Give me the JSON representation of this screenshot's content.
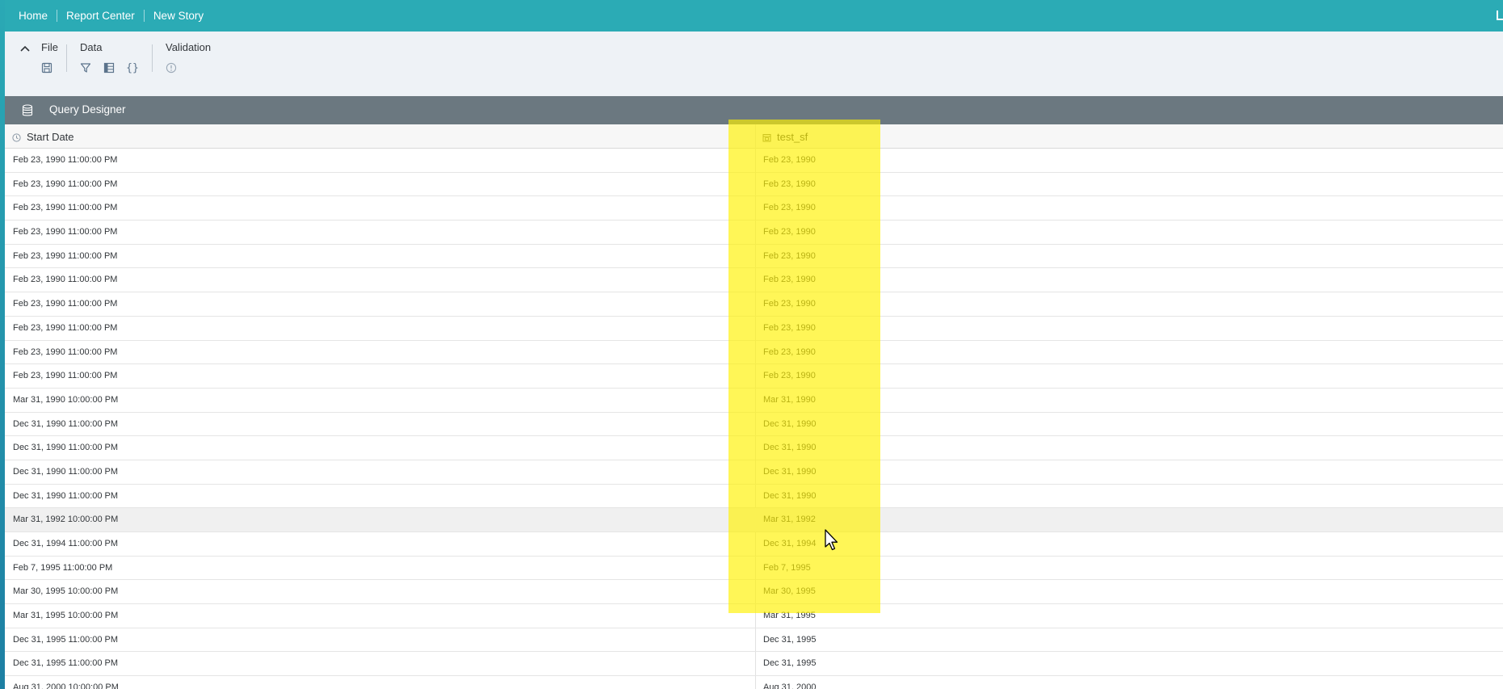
{
  "breadcrumbs": [
    "Home",
    "Report Center",
    "New Story"
  ],
  "toolbar": {
    "groups": {
      "file": "File",
      "data": "Data",
      "validation": "Validation"
    }
  },
  "query_designer": {
    "title": "Query Designer"
  },
  "table": {
    "columns": [
      "Start Date",
      "test_sf"
    ],
    "rows": [
      [
        "Feb 23, 1990 11:00:00 PM",
        "Feb 23, 1990"
      ],
      [
        "Feb 23, 1990 11:00:00 PM",
        "Feb 23, 1990"
      ],
      [
        "Feb 23, 1990 11:00:00 PM",
        "Feb 23, 1990"
      ],
      [
        "Feb 23, 1990 11:00:00 PM",
        "Feb 23, 1990"
      ],
      [
        "Feb 23, 1990 11:00:00 PM",
        "Feb 23, 1990"
      ],
      [
        "Feb 23, 1990 11:00:00 PM",
        "Feb 23, 1990"
      ],
      [
        "Feb 23, 1990 11:00:00 PM",
        "Feb 23, 1990"
      ],
      [
        "Feb 23, 1990 11:00:00 PM",
        "Feb 23, 1990"
      ],
      [
        "Feb 23, 1990 11:00:00 PM",
        "Feb 23, 1990"
      ],
      [
        "Feb 23, 1990 11:00:00 PM",
        "Feb 23, 1990"
      ],
      [
        "Mar 31, 1990 10:00:00 PM",
        "Mar 31, 1990"
      ],
      [
        "Dec 31, 1990 11:00:00 PM",
        "Dec 31, 1990"
      ],
      [
        "Dec 31, 1990 11:00:00 PM",
        "Dec 31, 1990"
      ],
      [
        "Dec 31, 1990 11:00:00 PM",
        "Dec 31, 1990"
      ],
      [
        "Dec 31, 1990 11:00:00 PM",
        "Dec 31, 1990"
      ],
      [
        "Mar 31, 1992 10:00:00 PM",
        "Mar 31, 1992"
      ],
      [
        "Dec 31, 1994 11:00:00 PM",
        "Dec 31, 1994"
      ],
      [
        "Feb 7, 1995 11:00:00 PM",
        "Feb 7, 1995"
      ],
      [
        "Mar 30, 1995 10:00:00 PM",
        "Mar 30, 1995"
      ],
      [
        "Mar 31, 1995 10:00:00 PM",
        "Mar 31, 1995"
      ],
      [
        "Dec 31, 1995 11:00:00 PM",
        "Dec 31, 1995"
      ],
      [
        "Dec 31, 1995 11:00:00 PM",
        "Dec 31, 1995"
      ],
      [
        "Aug 31, 2000 10:00:00 PM",
        "Aug 31, 2000"
      ]
    ],
    "hover_row_index": 15
  },
  "icons": {
    "collapse": "chevron-up-icon",
    "save": "save-icon",
    "filter": "filter-icon",
    "table_view": "table-icon",
    "formula": "curly-braces-icon",
    "validation": "info-icon",
    "database": "database-icon",
    "date_dimension": "clock-icon",
    "calculated": "calendar-icon"
  },
  "colors": {
    "shell_bar": "#2babb5",
    "toolbar_bg": "#eef2f6",
    "section_header": "#6b7880",
    "column_highlight": "#fff200"
  }
}
